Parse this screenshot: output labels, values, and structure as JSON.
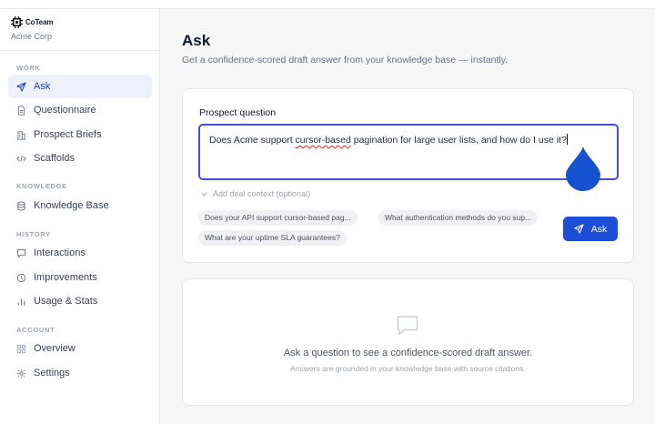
{
  "brand": {
    "name": "CoTeam",
    "org": "Acme Corp"
  },
  "sidebar": {
    "sections": [
      {
        "label": "WORK",
        "items": [
          {
            "label": "Ask",
            "icon": "send-icon",
            "active": true
          },
          {
            "label": "Questionnaire",
            "icon": "document-icon"
          },
          {
            "label": "Prospect Briefs",
            "icon": "building-icon"
          },
          {
            "label": "Scaffolds",
            "icon": "code-icon"
          }
        ]
      },
      {
        "label": "KNOWLEDGE",
        "items": [
          {
            "label": "Knowledge Base",
            "icon": "database-icon"
          }
        ]
      },
      {
        "label": "HISTORY",
        "items": [
          {
            "label": "Interactions",
            "icon": "chat-icon"
          },
          {
            "label": "Improvements",
            "icon": "lightbulb-icon"
          },
          {
            "label": "Usage & Stats",
            "icon": "bar-chart-icon"
          }
        ]
      },
      {
        "label": "ACCOUNT",
        "items": [
          {
            "label": "Overview",
            "icon": "grid-icon"
          },
          {
            "label": "Settings",
            "icon": "gear-icon"
          }
        ]
      }
    ]
  },
  "main": {
    "title": "Ask",
    "subtitle": "Get a confidence-scored draft answer from your knowledge base — instantly.",
    "question_label": "Prospect question",
    "question": {
      "before": "Does Acme support ",
      "misspelled": "cursor-based",
      "after": " pagination for large user lists, and how do I use it?"
    },
    "deal_context": "Add deal context (optional)",
    "suggestions": [
      "Does your API support cursor-based pag...",
      "What authentication methods do you sup...",
      "What are your uptime SLA guarantees?"
    ],
    "ask_button": "Ask",
    "empty_title": "Ask a question to see a confidence-scored draft answer.",
    "empty_subtitle": "Answers are grounded in your knowledge base with source citations."
  },
  "colors": {
    "accent": "#1d4ed8",
    "active_bg": "#eef1fb",
    "input_border": "#4350d6",
    "cursor_drop": "#1552d0"
  }
}
